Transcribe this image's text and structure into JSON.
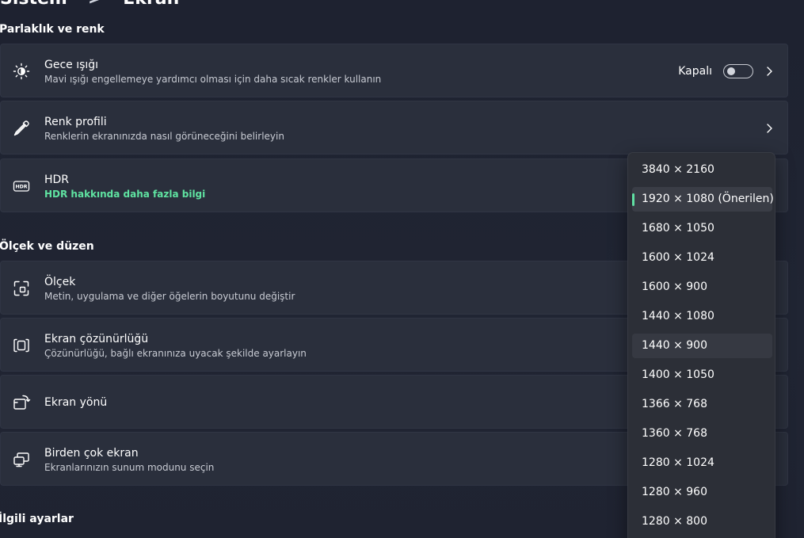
{
  "breadcrumb": {
    "parent": "Sistem",
    "separator": ">",
    "current": "Ekran"
  },
  "sections": {
    "brightness": "Parlaklık ve renk",
    "scale": "Ölçek ve düzen",
    "related": "İlgili ayarlar"
  },
  "cards": {
    "night_light": {
      "title": "Gece ışığı",
      "subtitle": "Mavi ışığı engellemeye yardımcı olması için daha sıcak renkler kullanın",
      "toggle_label": "Kapalı",
      "toggle_on": false
    },
    "color_profile": {
      "title": "Renk profili",
      "subtitle": "Renklerin ekranınızda nasıl görüneceğini belirleyin"
    },
    "hdr": {
      "title": "HDR",
      "link": "HDR hakkında daha fazla bilgi"
    },
    "scale": {
      "title": "Ölçek",
      "subtitle": "Metin, uygulama ve diğer öğelerin boyutunu değiştir"
    },
    "resolution": {
      "title": "Ekran çözünürlüğü",
      "subtitle": "Çözünürlüğü, bağlı ekranınıza uyacak şekilde ayarlayın"
    },
    "orientation": {
      "title": "Ekran yönü"
    },
    "multiple": {
      "title": "Birden çok ekran",
      "subtitle": "Ekranlarınızın sunum modunu seçin"
    }
  },
  "resolution_dropdown": {
    "selected": "1920 × 1080 (Önerilen)",
    "options": [
      "3840 × 2160",
      "1920 × 1080 (Önerilen)",
      "1680 × 1050",
      "1600 × 1024",
      "1600 × 900",
      "1440 × 1080",
      "1440 × 900",
      "1400 × 1050",
      "1366 × 768",
      "1360 × 768",
      "1280 × 1024",
      "1280 × 960",
      "1280 × 800"
    ]
  },
  "colors": {
    "accent": "#60e0a3",
    "card": "#2a2f3c",
    "background": "#1f2431"
  }
}
